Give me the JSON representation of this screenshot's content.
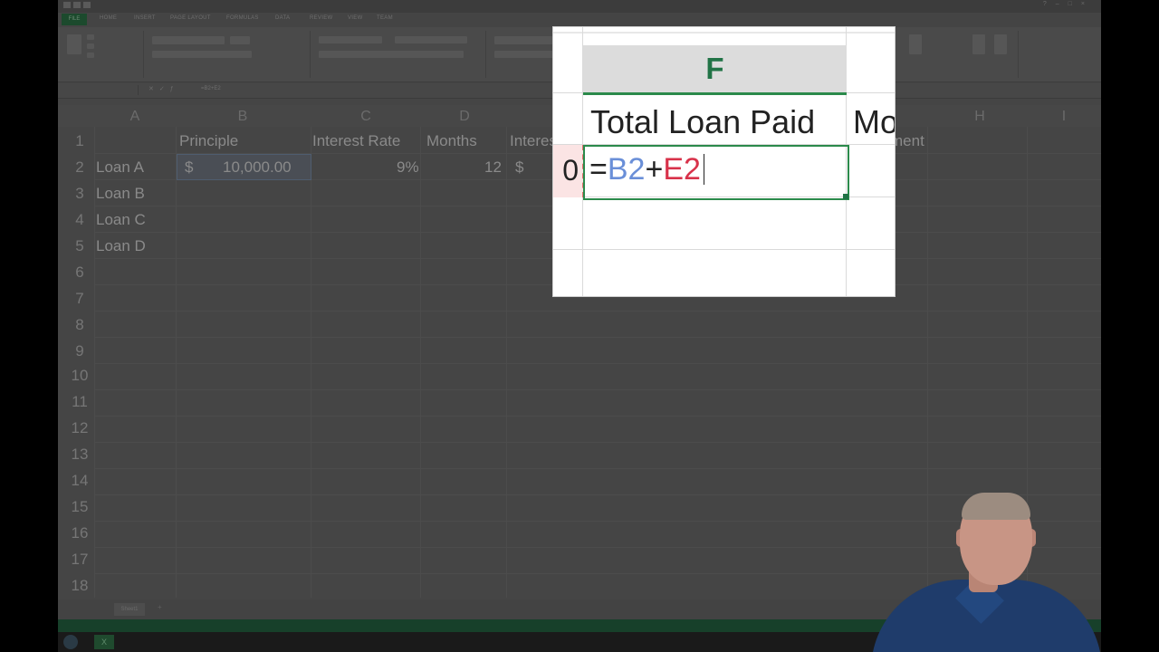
{
  "excel": {
    "file_tab": "FILE",
    "ribbon_tabs": [
      "HOME",
      "INSERT",
      "PAGE LAYOUT",
      "FORMULAS",
      "DATA",
      "REVIEW",
      "VIEW",
      "TEAM"
    ],
    "formula_bar_content": "=B2+E2",
    "column_headers": [
      "A",
      "B",
      "C",
      "D",
      "H",
      "I"
    ],
    "row_numbers": [
      "1",
      "2",
      "3",
      "4",
      "5",
      "6",
      "7",
      "8",
      "9",
      "10",
      "11",
      "12",
      "13",
      "14",
      "15",
      "16",
      "17",
      "18"
    ],
    "headers": {
      "b1": "Principle",
      "c1": "Interest Rate",
      "d1": "Months",
      "e1_partial": "Interes",
      "g1_partial": "ment"
    },
    "row2": {
      "a2": "Loan A",
      "b2_currency": "$",
      "b2_value": "10,000.00",
      "c2": "9%",
      "d2": "12",
      "e2_currency": "$"
    },
    "loans": [
      "Loan B",
      "Loan C",
      "Loan D"
    ],
    "sheet_tab": "Sheet1",
    "add_sheet": "+"
  },
  "zoom": {
    "column_letter": "F",
    "column_header_text": "Total Loan Paid",
    "next_column_partial": "Mo",
    "left_cell_partial": "0",
    "formula": {
      "equals": "=",
      "ref1": "B2",
      "plus": "+",
      "ref2": "E2"
    }
  },
  "colors": {
    "excel_green": "#217346",
    "ref_blue": "#6a8fd8",
    "ref_red": "#d8324a"
  }
}
